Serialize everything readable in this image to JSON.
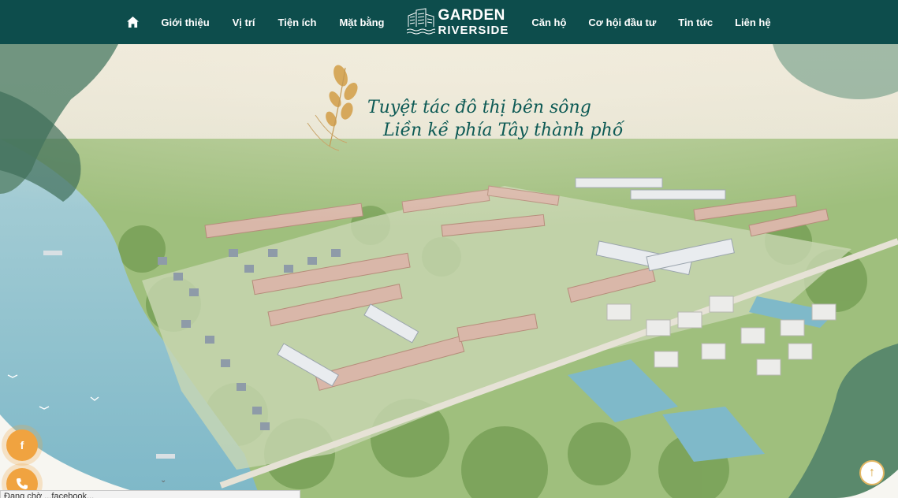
{
  "nav": {
    "home_icon": "home-icon",
    "left_links": [
      "Giới thiệu",
      "Vị trí",
      "Tiện ích",
      "Mặt bằng"
    ],
    "logo": {
      "line1": "GARDEN",
      "line2": "RIVERSIDE"
    },
    "right_links": [
      "Căn hộ",
      "Cơ hội đầu tư",
      "Tin tức",
      "Liên hệ"
    ]
  },
  "hero": {
    "tagline_line1": "Tuyệt tác đô thị bên sông",
    "tagline_line2": "Liền kề phía Tây thành phố"
  },
  "floating": {
    "facebook_icon": "facebook-icon",
    "phone_icon": "phone-icon",
    "scroll_top_icon": "arrow-up-icon"
  },
  "status": {
    "text": "Đang chờ ...facebook..."
  },
  "colors": {
    "nav_bg": "#0d4d4c",
    "accent": "#f0a340",
    "tagline": "#0d5a55"
  }
}
